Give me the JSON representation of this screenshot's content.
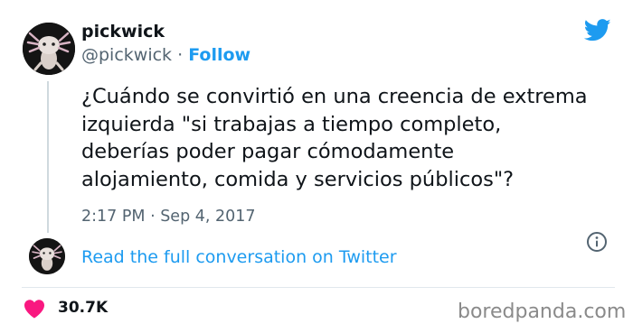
{
  "author": {
    "display_name": "pickwick",
    "handle": "@pickwick",
    "separator": " · ",
    "follow_label": "Follow"
  },
  "tweet": {
    "lines": [
      "¿Cuándo se convirtió en una creencia de extrema",
      "izquierda \"si trabajas a tiempo completo,",
      "deberías poder pagar cómodamente",
      "alojamiento, comida y servicios públicos\"?"
    ],
    "timestamp": "2:17 PM · Sep 4, 2017"
  },
  "conversation_link": "Read the full conversation on Twitter",
  "engagement": {
    "likes": "30.7K"
  },
  "watermark": "boredpanda.com",
  "colors": {
    "accent": "#1d9bf0",
    "heart": "#f91880",
    "muted_text": "#536471",
    "primary_text": "#0f1419"
  },
  "icons": {
    "brand": "twitter-bird-icon",
    "info": "info-icon",
    "like": "heart-icon"
  }
}
